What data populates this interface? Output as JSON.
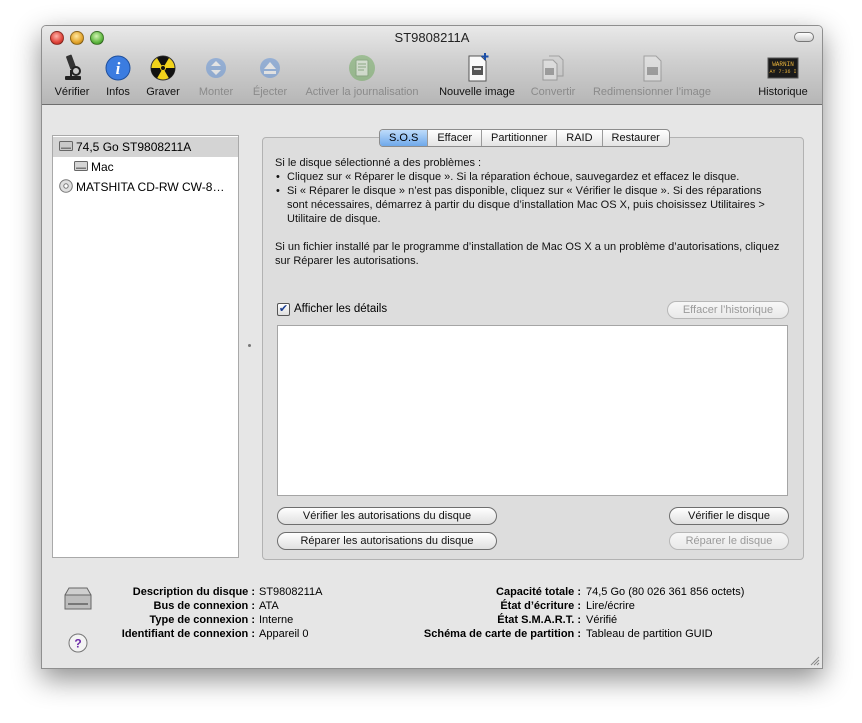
{
  "window": {
    "title": "ST9808211A"
  },
  "toolbar": {
    "verify": "Vérifier",
    "info": "Infos",
    "burn": "Graver",
    "mount": "Monter",
    "eject": "Éjecter",
    "journal": "Activer la journalisation",
    "new_image": "Nouvelle image",
    "convert": "Convertir",
    "resize": "Redimensionner l’image",
    "log": "Historique",
    "log_icon_text_1": "WARNIN",
    "log_icon_text_2": "AY 7:36 I"
  },
  "sidebar": {
    "items": [
      {
        "label": "74,5 Go ST9808211A",
        "icon": "hard-disk-icon"
      },
      {
        "label": "Mac",
        "icon": "volume-icon"
      },
      {
        "label": "MATSHITA CD-RW CW-8…",
        "icon": "optical-drive-icon"
      }
    ]
  },
  "tabs": [
    "S.O.S",
    "Effacer",
    "Partitionner",
    "RAID",
    "Restaurer"
  ],
  "first_aid": {
    "intro": "Si le disque sélectionné a des problèmes :",
    "bullet1": "Cliquez sur « Réparer le disque ». Si la réparation échoue, sauvegardez et effacez le disque.",
    "bullet2": "Si « Réparer le disque » n’est pas disponible, cliquez sur « Vérifier le disque ». Si des réparations sont nécessaires, démarrez à partir du disque d’installation Mac OS X, puis choisissez Utilitaires > Utilitaire de disque.",
    "permissions_note": "Si un fichier installé par le programme d’installation de Mac OS X a un problème d’autorisations, cliquez sur Réparer les autorisations.",
    "show_details": "Afficher les détails",
    "show_details_checked": true,
    "clear_history": "Effacer l’historique",
    "verify_permissions": "Vérifier les autorisations du disque",
    "repair_permissions": "Réparer les autorisations du disque",
    "verify_disk": "Vérifier le disque",
    "repair_disk": "Réparer le disque"
  },
  "details": {
    "description_label": "Description du disque :",
    "description_value": "ST9808211A",
    "bus_label": "Bus de connexion :",
    "bus_value": "ATA",
    "type_label": "Type de connexion :",
    "type_value": "Interne",
    "id_label": "Identifiant de connexion :",
    "id_value": "Appareil 0",
    "capacity_label": "Capacité totale :",
    "capacity_value": "74,5 Go (80 026 361 856 octets)",
    "write_label": "État d’écriture :",
    "write_value": "Lire/écrire",
    "smart_label": "État S.M.A.R.T. :",
    "smart_value": "Vérifié",
    "scheme_label": "Schéma de carte de partition :",
    "scheme_value": "Tableau de partition GUID"
  }
}
